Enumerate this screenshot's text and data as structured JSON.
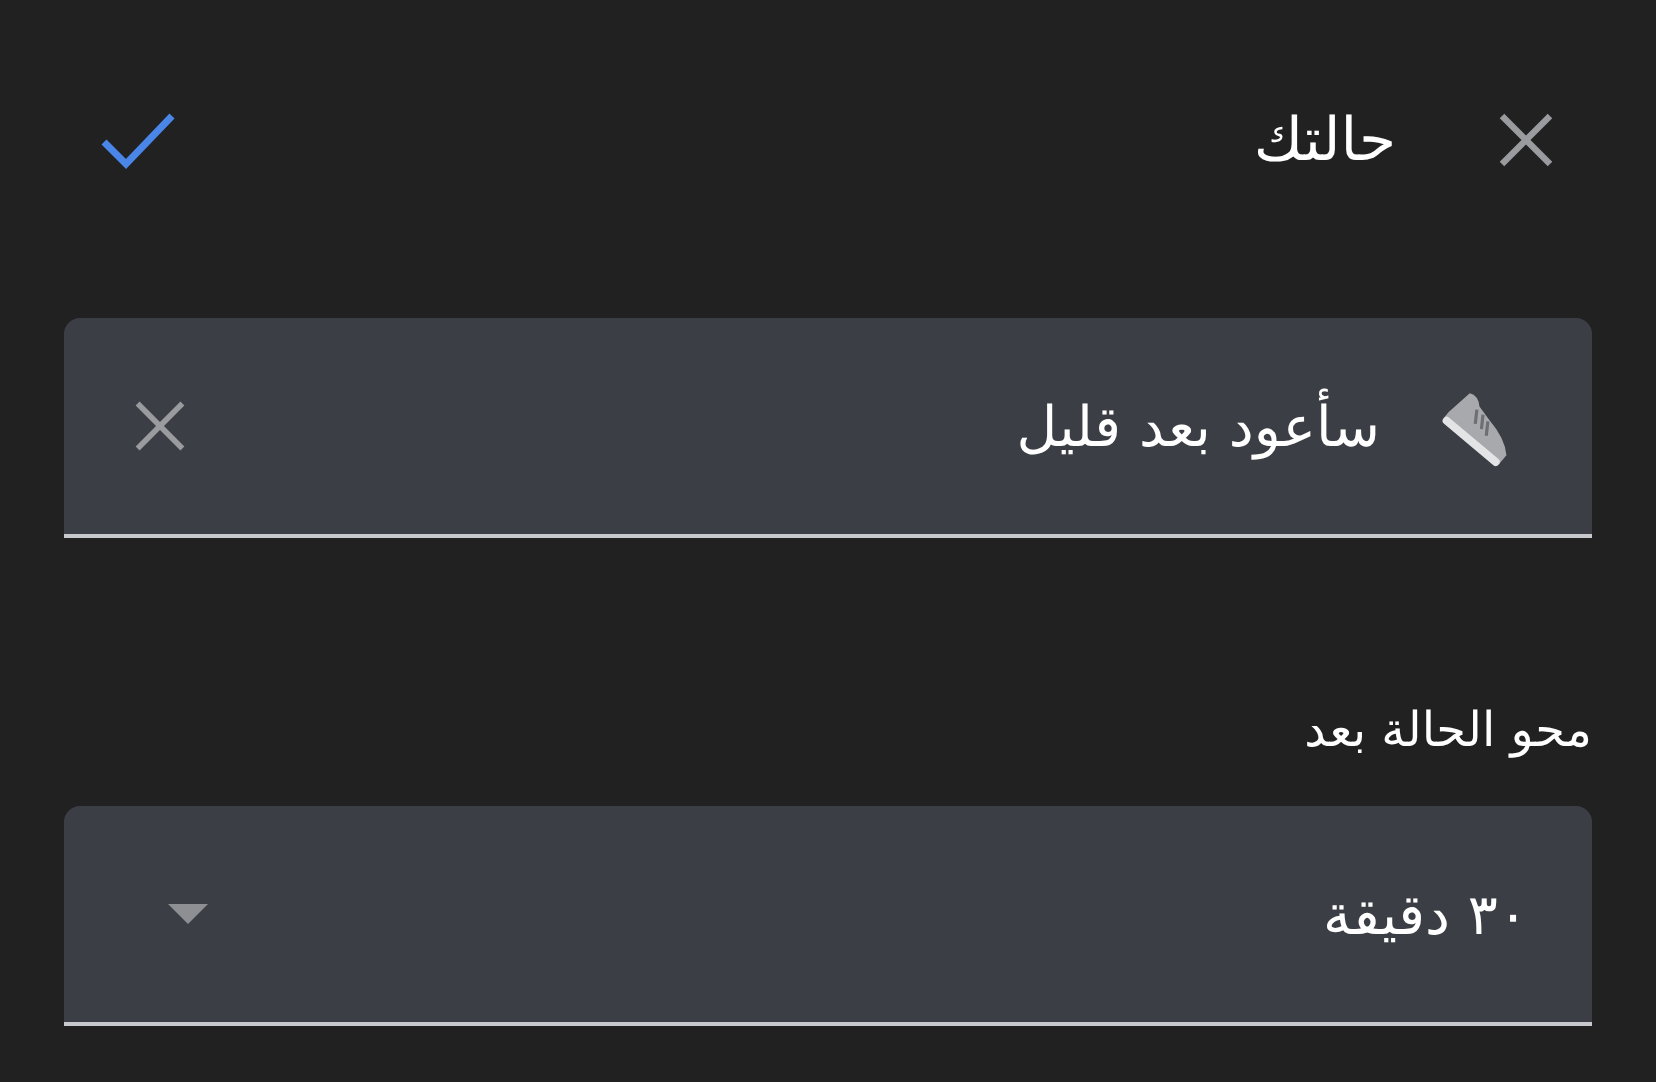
{
  "header": {
    "title": "حالتك"
  },
  "status_field": {
    "value": "سأعود بعد قليل"
  },
  "clear_after": {
    "label": "محو الحالة بعد",
    "value": "٣٠ دقيقة"
  }
}
